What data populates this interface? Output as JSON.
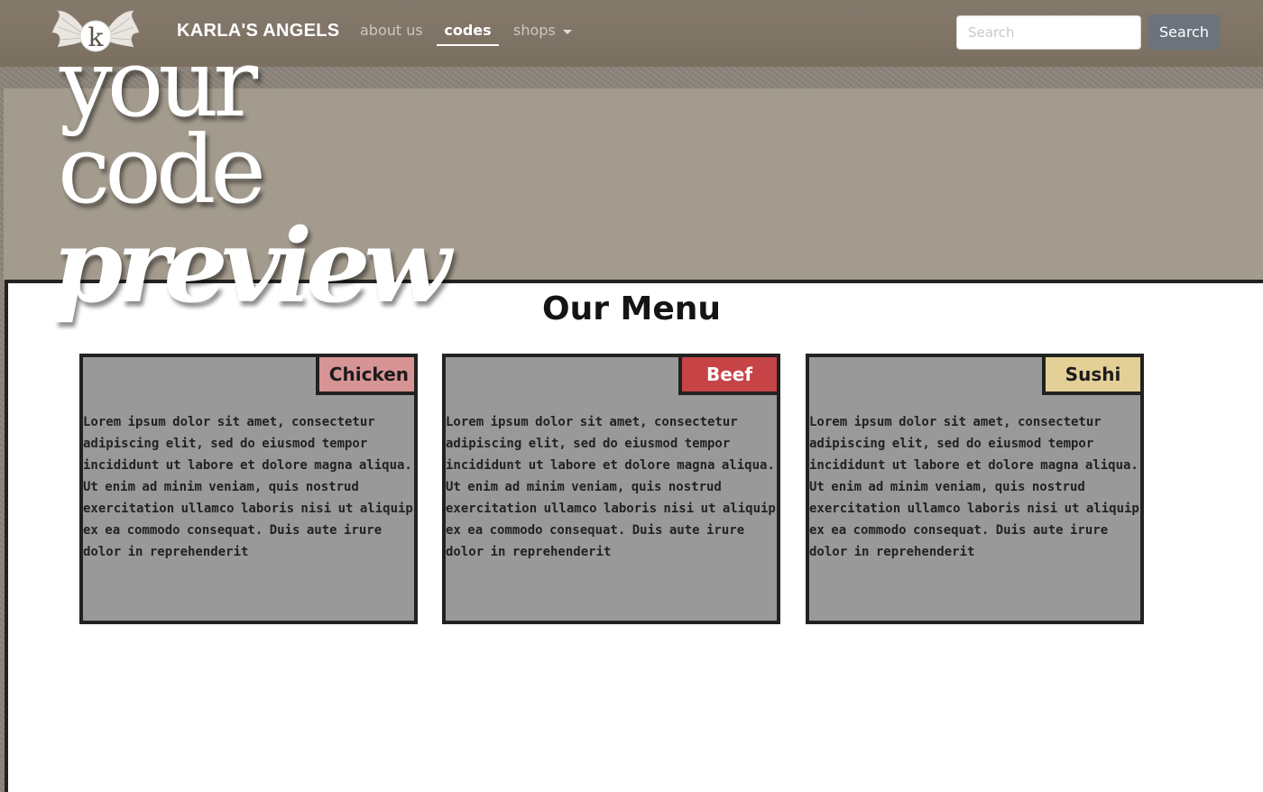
{
  "navbar": {
    "brand": "KARLA'S ANGELS",
    "logo_letter": "k",
    "links": [
      {
        "label": "about us",
        "active": false
      },
      {
        "label": "codes",
        "active": true
      },
      {
        "label": "shops",
        "active": false,
        "dropdown": true
      }
    ],
    "search": {
      "placeholder": "Search",
      "button_label": "Search"
    }
  },
  "hero": {
    "line1": "your",
    "line2": "code",
    "line3": "preview"
  },
  "menu": {
    "title": "Our Menu",
    "cards": [
      {
        "tag": "Chicken",
        "tag_color": "#d79495",
        "text": "Lorem ipsum dolor sit amet, consectetur adipiscing elit, sed do eiusmod tempor incididunt ut labore et dolore magna aliqua. Ut enim ad minim veniam, quis nostrud exercitation ullamco laboris nisi ut aliquip ex ea commodo consequat. Duis aute irure dolor in reprehenderit"
      },
      {
        "tag": "Beef",
        "tag_color": "#c64346",
        "text": "Lorem ipsum dolor sit amet, consectetur adipiscing elit, sed do eiusmod tempor incididunt ut labore et dolore magna aliqua. Ut enim ad minim veniam, quis nostrud exercitation ullamco laboris nisi ut aliquip ex ea commodo consequat. Duis aute irure dolor in reprehenderit"
      },
      {
        "tag": "Sushi",
        "tag_color": "#e3d096",
        "text": "Lorem ipsum dolor sit amet, consectetur adipiscing elit, sed do eiusmod tempor incididunt ut labore et dolore magna aliqua. Ut enim ad minim veniam, quis nostrud exercitation ullamco laboris nisi ut aliquip ex ea commodo consequat. Duis aute irure dolor in reprehenderit"
      }
    ]
  },
  "colors": {
    "navbar_bg": "#7f7466",
    "banner_bg": "#a39b8d",
    "card_bg": "#999999",
    "border": "#222222",
    "search_button": "#6c737c"
  }
}
